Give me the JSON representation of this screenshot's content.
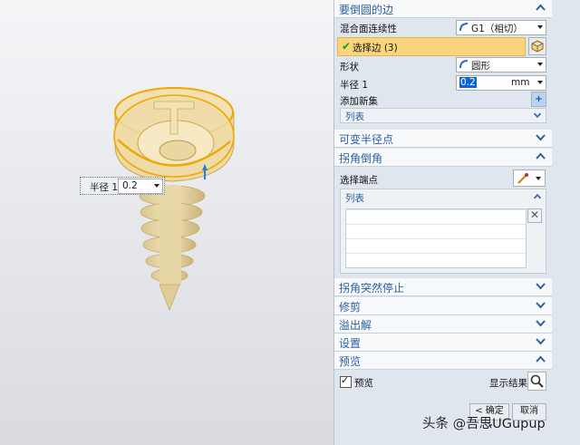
{
  "sections": {
    "edge_to_round": "要倒圆的边",
    "variable_radius": "可变半径点",
    "corner_setback": "拐角倒角",
    "corner_stop": "拐角突然停止",
    "trim": "修剪",
    "overflow": "溢出解",
    "settings": "设置",
    "preview": "预览"
  },
  "blend": {
    "continuity_label": "混合面连续性",
    "continuity_value": "G1（相切）",
    "select_edge_label": "选择边 (3)",
    "shape_label": "形状",
    "shape_value": "圆形",
    "radius_label": "半径 1",
    "radius_value": "0.2",
    "radius_unit": "mm",
    "add_new_set_label": "添加新集",
    "list_label": "列表"
  },
  "corner": {
    "select_endpoint_label": "选择端点",
    "list_label": "列表"
  },
  "preview": {
    "preview_checkbox_label": "预览",
    "preview_checked": true,
    "show_result_label": "显示结果"
  },
  "footer": {
    "ok_label": "< 确定 >",
    "cancel_label": "取消"
  },
  "viewport": {
    "radius_popup_label": "半径 1",
    "radius_popup_value": "0.2"
  },
  "watermark": "头条 @吾思UGupup",
  "colors": {
    "section_title": "#2b5fa1",
    "selection_highlight": "#fbd57d",
    "model_yellow": "#e8c56a",
    "edge_orange": "#f0a800"
  }
}
